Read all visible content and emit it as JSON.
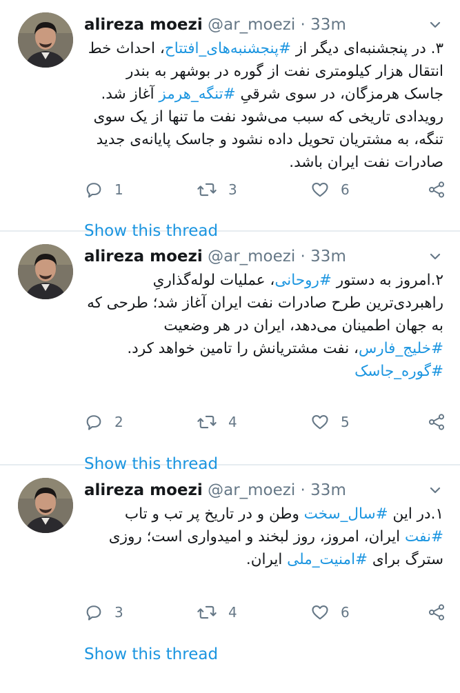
{
  "tweets": [
    {
      "author_name": "alireza moezi",
      "author_handle": "@ar_moezi",
      "separator": "·",
      "time": "33m",
      "body": [
        {
          "t": "text",
          "v": "۳. در پنجشنبه‌ای دیگر از "
        },
        {
          "t": "tag",
          "v": "#پنجشنبه‌های_افتتاح"
        },
        {
          "t": "text",
          "v": "، احداث خط انتقال هزار کیلومتری نفت از گوره در بوشهر به بندر جاسک هرمزگان، در سوی شرقیِ "
        },
        {
          "t": "tag",
          "v": "#تنگه_هرمز"
        },
        {
          "t": "text",
          "v": " آغاز شد. رویدادی تاریخی که سبب می‌شود نفت ما تنها از یک سوی تنگه، به مشتریان تحویل داده نشود و جاسک پایانه‌ی جدید صادرات نفت ایران باشد."
        }
      ],
      "replies": "1",
      "retweets": "3",
      "likes": "6",
      "show_thread": "Show this thread"
    },
    {
      "author_name": "alireza moezi",
      "author_handle": "@ar_moezi",
      "separator": "·",
      "time": "33m",
      "body": [
        {
          "t": "text",
          "v": "۲.امروز به دستور "
        },
        {
          "t": "tag",
          "v": "#روحانی"
        },
        {
          "t": "text",
          "v": "، عملیات لوله‌گذاریِ راهبردی‌ترین طرح صادرات نفت ایران آغاز شد؛ طرحی که به جهان اطمینان می‌دهد، ایران در هر وضعیت "
        },
        {
          "t": "tag",
          "v": "#خلیج_فارس"
        },
        {
          "t": "text",
          "v": "، نفت مشتریانش را تامین خواهد کرد. "
        },
        {
          "t": "tag",
          "v": "#گوره_جاسک"
        }
      ],
      "replies": "2",
      "retweets": "4",
      "likes": "5",
      "show_thread": "Show this thread"
    },
    {
      "author_name": "alireza moezi",
      "author_handle": "@ar_moezi",
      "separator": "·",
      "time": "33m",
      "body": [
        {
          "t": "text",
          "v": "۱.در این "
        },
        {
          "t": "tag",
          "v": "#سال_سخت"
        },
        {
          "t": "text",
          "v": " وطن و در تاریخ پر تب و تاب "
        },
        {
          "t": "tag",
          "v": "#نفت"
        },
        {
          "t": "text",
          "v": " ایران، امروز، روز لبخند و امیدواری است؛ روزی سترگ برای "
        },
        {
          "t": "tag",
          "v": "#امنیت_ملی"
        },
        {
          "t": "text",
          "v": " ایران."
        }
      ],
      "replies": "3",
      "retweets": "4",
      "likes": "6",
      "show_thread": "Show this thread"
    }
  ],
  "icons": {
    "reply": "reply-icon",
    "retweet": "retweet-icon",
    "like": "heart-icon",
    "share": "share-icon",
    "caret": "chevron-down-icon"
  },
  "colors": {
    "link": "#1b95e0",
    "muted": "#657786",
    "text": "#14171a",
    "divider": "#e6ecf0"
  }
}
